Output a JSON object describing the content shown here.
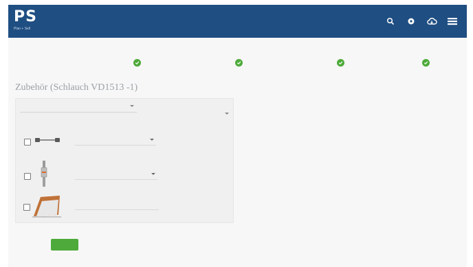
{
  "brand": {
    "logo_text": "PS",
    "tagline": "Plan + Sell"
  },
  "header_icons": [
    "search-icon",
    "settings-icon",
    "cloud-icon",
    "menu-icon"
  ],
  "breadcrumb": "",
  "steps": [
    {
      "label": "",
      "state": "done"
    },
    {
      "label": "",
      "state": "done"
    },
    {
      "label": "",
      "state": "active"
    },
    {
      "label": "",
      "state": "done"
    }
  ],
  "page_title": "Zubehör (Schlauch VD1513 -1)",
  "panel": {
    "select_label": ""
  },
  "items": [
    {
      "name": "",
      "quantity_placeholder": "",
      "thumb": "cable-icon"
    },
    {
      "name": "",
      "quantity_placeholder": "",
      "thumb": "fitting-icon"
    },
    {
      "name": "",
      "quantity_placeholder": "",
      "thumb": "panel-icon"
    }
  ],
  "actions": {
    "back_label": "",
    "next_label": ""
  },
  "colors": {
    "header": "#1f4e82",
    "accent": "#4eaa3a"
  }
}
